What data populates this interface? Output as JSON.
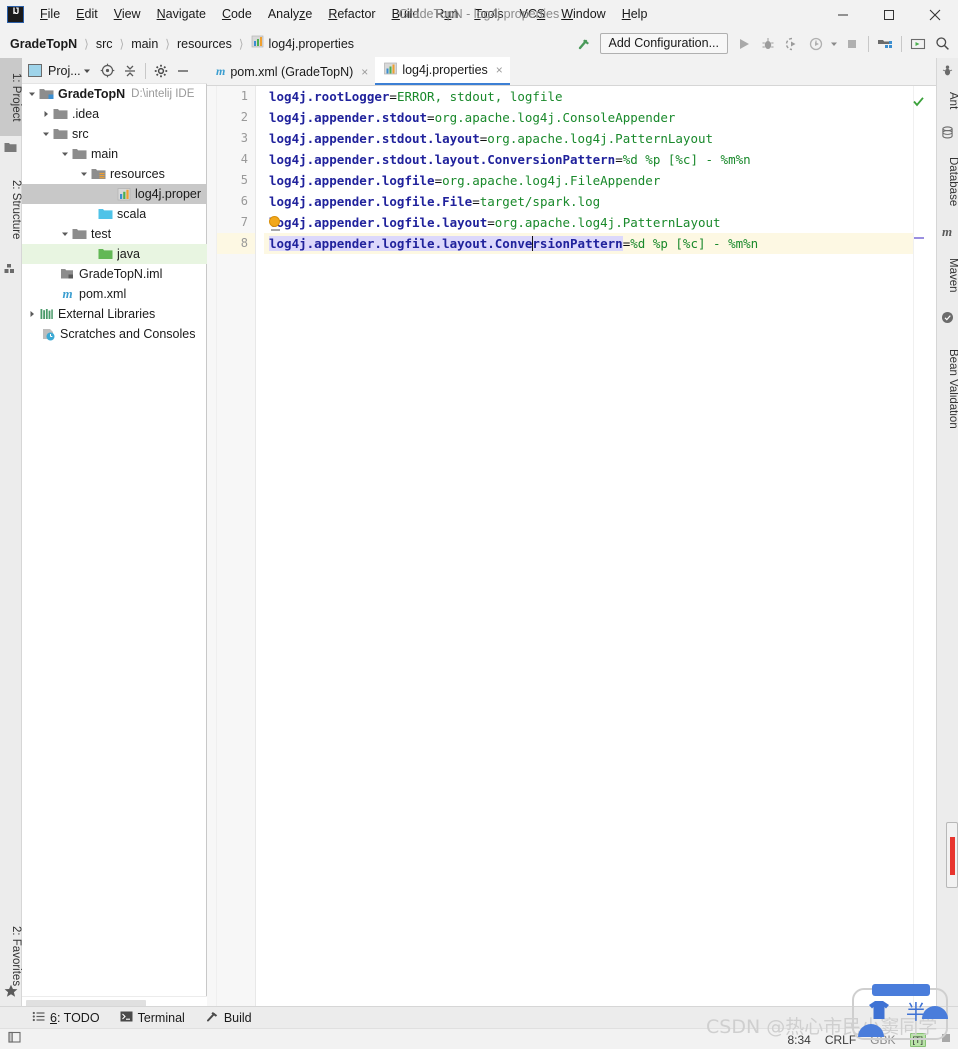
{
  "window": {
    "title": "GradeTopN - log4j.properties",
    "logo": "intellij-idea-logo",
    "minimize_label": "minimize-icon",
    "maximize_label": "maximize-icon",
    "close_label": "close-icon"
  },
  "menubar": {
    "items": [
      {
        "label": "File",
        "mnemonic": "F"
      },
      {
        "label": "Edit",
        "mnemonic": "E"
      },
      {
        "label": "View",
        "mnemonic": "V"
      },
      {
        "label": "Navigate",
        "mnemonic": "N"
      },
      {
        "label": "Code",
        "mnemonic": "C"
      },
      {
        "label": "Analyze",
        "mnemonic": "z"
      },
      {
        "label": "Refactor",
        "mnemonic": "R"
      },
      {
        "label": "Build",
        "mnemonic": "B"
      },
      {
        "label": "Run",
        "mnemonic": "u"
      },
      {
        "label": "Tools",
        "mnemonic": "T"
      },
      {
        "label": "VCS",
        "mnemonic": "S"
      },
      {
        "label": "Window",
        "mnemonic": "W"
      },
      {
        "label": "Help",
        "mnemonic": "H"
      }
    ]
  },
  "breadcrumb": {
    "items": [
      "GradeTopN",
      "src",
      "main",
      "resources",
      "log4j.properties"
    ],
    "separator": "〉",
    "file_icon": "properties-file-icon"
  },
  "toolbar": {
    "hammer_icon": "build-hammer-icon",
    "add_configuration_label": "Add Configuration...",
    "run_icon": "run-icon",
    "debug_icon": "debug-icon",
    "run_coverage_icon": "run-with-coverage-icon",
    "profile_icon": "profile-icon",
    "profile_dropdown_icon": "chevron-down-icon",
    "stop_icon": "stop-icon",
    "project_structure_icon": "project-structure-icon",
    "update_icon": "update-running-application-icon",
    "search_icon": "search-everywhere-icon"
  },
  "left_strip": {
    "tabs": [
      {
        "label": "1: Project",
        "mnemonic": "1",
        "icon": "project-folder-icon",
        "active": true
      },
      {
        "label": "2: Structure",
        "mnemonic": "2",
        "icon": "structure-icon",
        "active": false
      },
      {
        "label": "2: Favorites",
        "mnemonic": "2",
        "icon": "star-icon",
        "active": false
      }
    ]
  },
  "right_strip": {
    "tabs": [
      {
        "label": "Ant",
        "icon": "ant-icon"
      },
      {
        "label": "Database",
        "icon": "database-icon"
      },
      {
        "label": "Maven",
        "icon": "maven-m-icon"
      },
      {
        "label": "Bean Validation",
        "icon": "bean-validation-icon"
      }
    ]
  },
  "project_panel": {
    "title": "Proj...",
    "dropdown_icon": "chevron-down-icon",
    "view_icon": "project-view-icon",
    "locate_icon": "select-opened-file-icon",
    "collapse_icon": "collapse-all-icon",
    "settings_icon": "gear-icon",
    "hide_icon": "hide-icon",
    "tree": [
      {
        "label": "GradeTopN",
        "path": "D:\\intelij IDE",
        "indent": 0,
        "arrow": "down",
        "icon": "module-folder-icon",
        "bold": true,
        "state": "normal"
      },
      {
        "label": ".idea",
        "path": "",
        "indent": 1,
        "arrow": "right",
        "icon": "folder-icon",
        "bold": false,
        "state": "normal"
      },
      {
        "label": "src",
        "path": "",
        "indent": 1,
        "arrow": "down",
        "icon": "folder-icon",
        "bold": false,
        "state": "normal"
      },
      {
        "label": "main",
        "path": "",
        "indent": 2,
        "arrow": "down",
        "icon": "folder-icon",
        "bold": false,
        "state": "normal"
      },
      {
        "label": "resources",
        "path": "",
        "indent": 3,
        "arrow": "down",
        "icon": "resources-folder-icon",
        "bold": false,
        "state": "normal"
      },
      {
        "label": "log4j.proper",
        "path": "",
        "indent": 5,
        "arrow": "none",
        "icon": "properties-file-icon",
        "bold": false,
        "state": "selected"
      },
      {
        "label": "scala",
        "path": "",
        "indent": 4,
        "arrow": "none",
        "icon": "sources-folder-icon",
        "bold": false,
        "state": "normal"
      },
      {
        "label": "test",
        "path": "",
        "indent": 2,
        "arrow": "down",
        "icon": "folder-icon",
        "bold": false,
        "state": "normal"
      },
      {
        "label": "java",
        "path": "",
        "indent": 4,
        "arrow": "none",
        "icon": "test-sources-folder-icon",
        "bold": false,
        "state": "green"
      },
      {
        "label": "GradeTopN.iml",
        "path": "",
        "indent": 2,
        "arrow": "none",
        "icon": "iml-file-icon",
        "bold": false,
        "state": "normal"
      },
      {
        "label": "pom.xml",
        "path": "",
        "indent": 2,
        "arrow": "none",
        "icon": "maven-m-icon",
        "bold": false,
        "state": "normal"
      },
      {
        "label": "External Libraries",
        "path": "",
        "indent": 1,
        "arrow": "right",
        "icon": "libraries-icon",
        "bold": false,
        "state": "normal"
      },
      {
        "label": "Scratches and Consoles",
        "path": "",
        "indent": 1,
        "arrow": "none",
        "icon": "scratches-icon",
        "bold": false,
        "state": "normal"
      }
    ]
  },
  "editor_tabs": [
    {
      "label": "pom.xml (GradeTopN)",
      "icon": "maven-m-icon",
      "active": false,
      "close": "×"
    },
    {
      "label": "log4j.properties",
      "icon": "properties-file-icon",
      "active": true,
      "close": "×"
    }
  ],
  "editor": {
    "current_line": 8,
    "caret_column": 34,
    "inspection_status": "ok-checkmark-icon",
    "lines": [
      {
        "n": "1",
        "key": "log4j.rootLogger",
        "eq": "=",
        "value": "ERROR, stdout, logfile"
      },
      {
        "n": "2",
        "key": "log4j.appender.stdout",
        "eq": "=",
        "value": "org.apache.log4j.ConsoleAppender"
      },
      {
        "n": "3",
        "key": "log4j.appender.stdout.layout",
        "eq": "=",
        "value": "org.apache.log4j.PatternLayout"
      },
      {
        "n": "4",
        "key": "log4j.appender.stdout.layout.ConversionPattern",
        "eq": "=",
        "value": "%d %p [%c] - %m%n"
      },
      {
        "n": "5",
        "key": "log4j.appender.logfile",
        "eq": "=",
        "value": "org.apache.log4j.FileAppender"
      },
      {
        "n": "6",
        "key": "log4j.appender.logfile.File",
        "eq": "=",
        "value": "target/spark.log"
      },
      {
        "n": "7",
        "key": "log4j.appender.logfile.layout",
        "eq": "=",
        "value": "org.apache.log4j.PatternLayout"
      },
      {
        "n": "8",
        "key": "log4j.appender.logfile.layout.ConversionPattern",
        "eq": "=",
        "value": "%d %p [%c] - %m%n"
      }
    ],
    "colors": {
      "key": "#20229c",
      "value": "#19892b",
      "current_line_bg": "#fdf8e3",
      "identifier_highlight_bg": "#dcd8fb"
    }
  },
  "bottom_tabs": [
    {
      "label": "6: TODO",
      "mnemonic": "6",
      "icon": "todo-list-icon"
    },
    {
      "label": "Terminal",
      "mnemonic": "",
      "icon": "terminal-icon"
    },
    {
      "label": "Build",
      "mnemonic": "",
      "icon": "build-hammer-icon"
    }
  ],
  "statusbar": {
    "toggle_icon": "show-tool-window-bars-icon",
    "caret_position": "8:34",
    "line_separator": "CRLF",
    "encoding": "GBK",
    "ime_badge": "[T]",
    "lock_icon": "read-only-toggle-icon"
  },
  "watermark": {
    "text": "CSDN @热心市民小窦同学"
  },
  "ime_panel": {
    "mode_char": "半",
    "shirt_icon": "ime-skin-shirt-icon"
  }
}
